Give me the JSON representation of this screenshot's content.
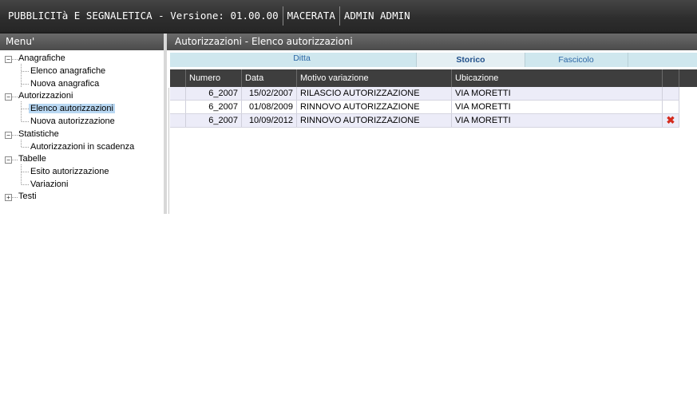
{
  "topbar": {
    "app_title": "PUBBLICITà E SEGNALETICA - Versione: 01.00.00",
    "city": "MACERATA",
    "user": "ADMIN ADMIN"
  },
  "menu": {
    "header": "Menu'",
    "items": [
      {
        "label": "Anagrafiche",
        "expanded": true,
        "children": [
          "Elenco anagrafiche",
          "Nuova anagrafica"
        ]
      },
      {
        "label": "Autorizzazioni",
        "expanded": true,
        "children": [
          "Elenco autorizzazioni",
          "Nuova autorizzazione"
        ]
      },
      {
        "label": "Statistiche",
        "expanded": true,
        "children": [
          "Autorizzazioni in scadenza"
        ]
      },
      {
        "label": "Tabelle",
        "expanded": true,
        "children": [
          "Esito autorizzazione",
          "Variazioni"
        ]
      },
      {
        "label": "Testi",
        "expanded": false,
        "children": []
      }
    ],
    "selected": "Elenco autorizzazioni"
  },
  "main": {
    "title": "Autorizzazioni - Elenco autorizzazioni",
    "tabs": [
      {
        "label": "Ditta",
        "active": false
      },
      {
        "label": "Storico",
        "active": true
      },
      {
        "label": "Fascicolo",
        "active": false
      }
    ],
    "table": {
      "columns": [
        "Numero",
        "Data",
        "Motivo variazione",
        "Ubicazione"
      ],
      "rows": [
        {
          "numero": "6_2007",
          "data": "15/02/2007",
          "motivo": "RILASCIO AUTORIZZAZIONE",
          "ubicazione": "VIA MORETTI",
          "delete_icon": false
        },
        {
          "numero": "6_2007",
          "data": "01/08/2009",
          "motivo": "RINNOVO AUTORIZZAZIONE",
          "ubicazione": "VIA MORETTI",
          "delete_icon": false
        },
        {
          "numero": "6_2007",
          "data": "10/09/2012",
          "motivo": "RINNOVO AUTORIZZAZIONE",
          "ubicazione": "VIA MORETTI",
          "delete_icon": true
        }
      ]
    }
  },
  "icons": {
    "delete": "delete-icon",
    "expand": "plus-icon",
    "collapse": "minus-icon"
  },
  "colors": {
    "topbar": "#2e2e2e",
    "selected_item": "#b9d8f3",
    "tabs_bg": "#cfe7ee",
    "delete_icon": "#d42a1c"
  }
}
